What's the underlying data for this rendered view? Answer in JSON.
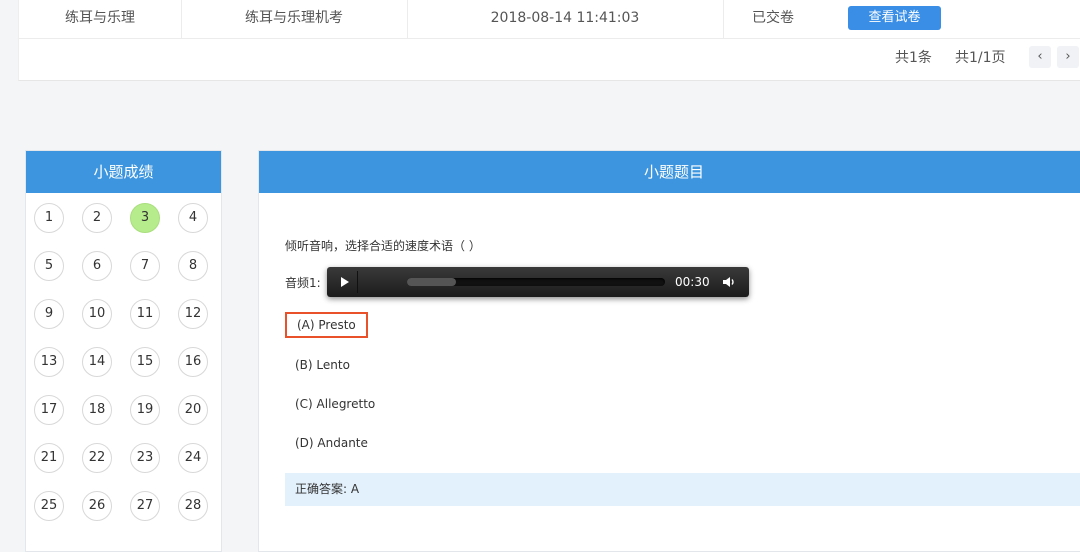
{
  "records": {
    "row": {
      "subject": "练耳与乐理",
      "exam_name": "练耳与乐理机考",
      "datetime": "2018-08-14 11:41:03",
      "status": "已交卷",
      "action_label": "查看试卷"
    },
    "pager": {
      "total_items": "共1条",
      "page_info": "共1/1页",
      "prev_icon": "chevron-left-icon",
      "next_icon": "chevron-right-icon"
    }
  },
  "left_panel": {
    "title": "小题成绩",
    "questions": [
      "1",
      "2",
      "3",
      "4",
      "5",
      "6",
      "7",
      "8",
      "9",
      "10",
      "11",
      "12",
      "13",
      "14",
      "15",
      "16",
      "17",
      "18",
      "19",
      "20",
      "21",
      "22",
      "23",
      "24",
      "25",
      "26",
      "27",
      "28"
    ],
    "current": "3",
    "current_color": "#b7ec8c"
  },
  "right_panel": {
    "title": "小题题目",
    "question_text": "倾听音响，选择合适的速度术语（ ）",
    "audio": {
      "label": "音频1:",
      "time": "00:30",
      "buffered_fraction": 0.19,
      "play_icon": "play-icon",
      "volume_icon": "volume-icon"
    },
    "options": [
      {
        "label": "(A) Presto",
        "selected": true
      },
      {
        "label": "(B) Lento",
        "selected": false
      },
      {
        "label": "(C) Allegretto",
        "selected": false
      },
      {
        "label": "(D) Andante",
        "selected": false
      }
    ],
    "answer_text": "正确答案: A",
    "selected_border_color": "#e8512a"
  },
  "colors": {
    "header_blue": "#3c95de",
    "button_blue": "#3a8ee6",
    "answer_bg": "#e3f1fc"
  }
}
